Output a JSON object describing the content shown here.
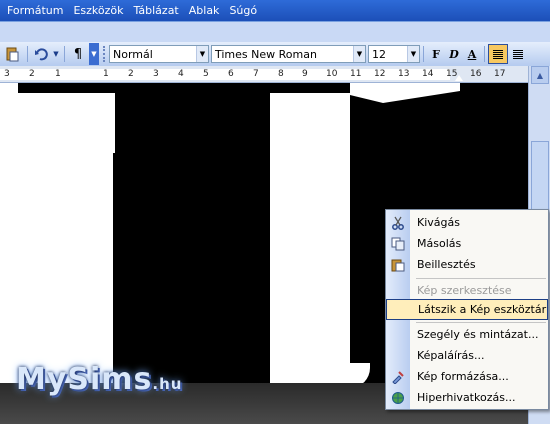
{
  "menubar": {
    "items": [
      "Formátum",
      "Eszközök",
      "Táblázat",
      "Ablak",
      "Súgó"
    ]
  },
  "toolbar": {
    "pilcrow": "¶",
    "style_value": "Normál",
    "font_value": "Times New Roman",
    "size_value": "12",
    "bold": "F",
    "italic": "D",
    "underline": "A"
  },
  "ruler": {
    "numbers": [
      "3",
      "2",
      "1",
      "1",
      "2",
      "3",
      "4",
      "5",
      "6",
      "7",
      "8",
      "9",
      "10",
      "11",
      "12",
      "13",
      "14",
      "15",
      "16",
      "17"
    ]
  },
  "context_menu": {
    "items": [
      {
        "label": "Kivágás",
        "icon": "scissors-icon",
        "disabled": false,
        "highlight": false
      },
      {
        "label": "Másolás",
        "icon": "copy-icon",
        "disabled": false,
        "highlight": false
      },
      {
        "label": "Beillesztés",
        "icon": "paste-icon",
        "disabled": false,
        "highlight": false
      },
      {
        "label": "Kép szerkesztése",
        "icon": "",
        "disabled": true,
        "highlight": false
      },
      {
        "label": "Látszik a Kép eszköztár",
        "icon": "",
        "disabled": false,
        "highlight": true
      },
      {
        "label": "Szegély és mintázat...",
        "icon": "",
        "disabled": false,
        "highlight": false
      },
      {
        "label": "Képaláírás...",
        "icon": "",
        "disabled": false,
        "highlight": false
      },
      {
        "label": "Kép formázása...",
        "icon": "format-picture-icon",
        "disabled": false,
        "highlight": false
      },
      {
        "label": "Hiperhivatkozás...",
        "icon": "hyperlink-icon",
        "disabled": false,
        "highlight": false
      }
    ]
  },
  "logo": {
    "main": "MySims",
    "suffix": ".hu"
  },
  "colors": {
    "menubar": "#2561cf",
    "highlight": "#ffeebb",
    "highlight_border": "#1d3f86"
  }
}
